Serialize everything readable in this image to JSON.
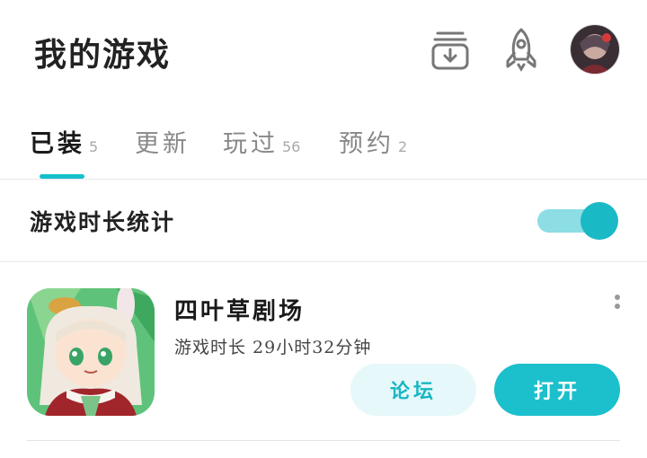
{
  "header": {
    "title": "我的游戏",
    "download_icon": "download-box-icon",
    "rocket_icon": "rocket-icon"
  },
  "tabs": [
    {
      "label": "已装",
      "count": "5"
    },
    {
      "label": "更新",
      "count": ""
    },
    {
      "label": "玩过",
      "count": "56"
    },
    {
      "label": "预约",
      "count": "2"
    }
  ],
  "stats": {
    "label": "游戏时长统计",
    "toggle_on": true
  },
  "games": [
    {
      "name": "四叶草剧场",
      "playtime": "游戏时长 29小时32分钟",
      "forum_label": "论坛",
      "open_label": "打开"
    }
  ],
  "colors": {
    "accent": "#17c0cd",
    "toggle_track": "#8ddde4",
    "forum_bg": "#e6f8fa"
  }
}
